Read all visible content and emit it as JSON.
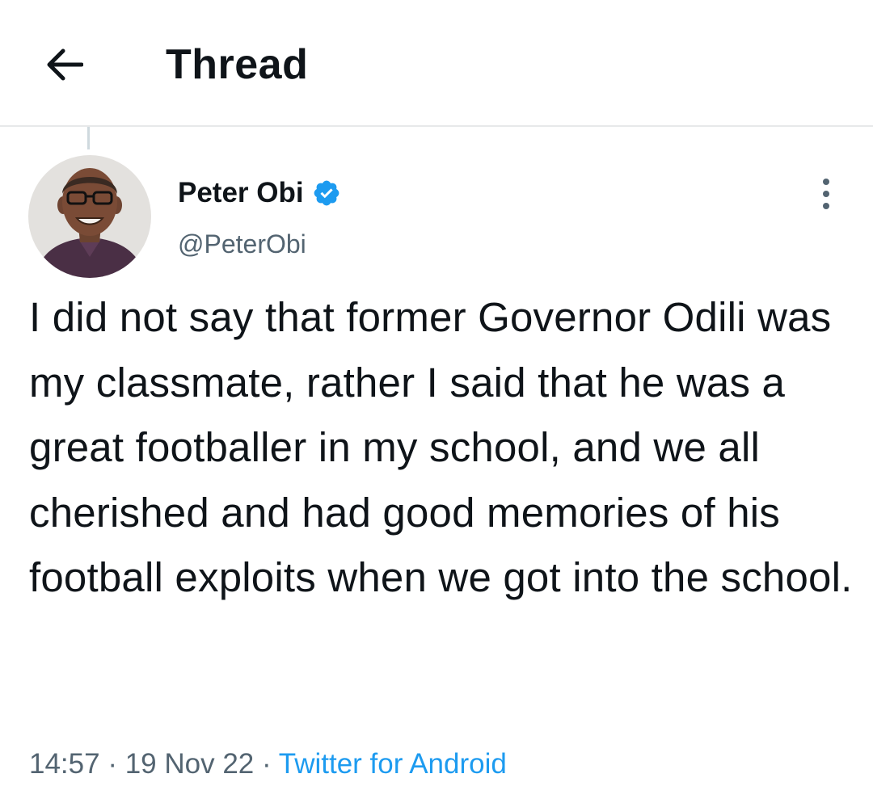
{
  "header": {
    "back_icon": "arrow-left-icon",
    "title": "Thread"
  },
  "tweet": {
    "author": {
      "name": "Peter Obi",
      "handle": "@PeterObi",
      "verified_icon": "verified-badge-icon",
      "avatar_icon": "avatar-photo"
    },
    "more_icon": "more-vertical-icon",
    "text": "I did not say that former Governor Odili was my classmate, rather I said that he was a great footballer in my school, and we all cherished and had good memories of his football exploits when we got into the school.",
    "time": "14:57",
    "separator": "·",
    "date": "19 Nov 22",
    "source": "Twitter for Android"
  },
  "colors": {
    "text": "#0f1419",
    "secondary": "#536471",
    "accent": "#1d9bf0",
    "divider": "#e7e9ea"
  }
}
